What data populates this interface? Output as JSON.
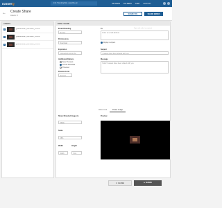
{
  "topbar": {
    "logo_main": "runner",
    "logo_accent": "Q",
    "search_text": "Inbr. 'Branding Bat', assetIDs_En",
    "nav": [
      "UPLOADS",
      "FOLDERS",
      "CART",
      "ACTIVITY"
    ]
  },
  "header": {
    "title": "Create Share",
    "subtitle": "Assets: 3",
    "back_icon": "arrow-left-icon",
    "btn_url": "SHARE URL",
    "btn_embed": "SHARE EMBED"
  },
  "assets": {
    "heading": "ASSETS",
    "items": [
      {
        "name": "@BestRunner_AIRrunner_23.mov"
      },
      {
        "name": "@BestRunner_AIRrunner_24.mov"
      },
      {
        "name": "@BestRunner_AIRrunner_25.mov"
      }
    ]
  },
  "form": {
    "heading": "EMAIL SHARE",
    "email_branding_label": "Email Branding",
    "email_branding_value": "Runner",
    "permissions_label": "Permissions",
    "permissions_value": "Download",
    "expiration_label": "Expiration",
    "expiration_value": "01/24/2018 04:21 PM",
    "additional_label": "Additional Options",
    "options": [
      "Save Previews",
      "Include Metadata",
      "Protected"
    ],
    "preview_limit_label": "Preview Limit",
    "preview_limit_value": "Second",
    "to_label": "To",
    "to_hint": "Type and select a recipient",
    "to_value": "Enter an email address",
    "display_label": "Display recipient",
    "subject_label": "Subject",
    "subject_value": "3 assets have been shared with you",
    "message_label": "Message",
    "message_value": "Hello! 3 assets have been shared with you.",
    "tab_watermark": "Watermark",
    "tab_posterimage": "Poster Image",
    "share_image_label": "Share Branded Image As",
    "share_image_value": "JPEG",
    "scale_label": "Scale",
    "scale_value": "25%",
    "width_label": "Width",
    "width_value": "Width",
    "height_label": "Height",
    "height_value": "Size",
    "preview_label": "Preview"
  },
  "footer": {
    "close": "CLOSE",
    "share": "SHARE"
  },
  "colors": {
    "brand": "#1f5e94",
    "accent": "#f08a24"
  }
}
